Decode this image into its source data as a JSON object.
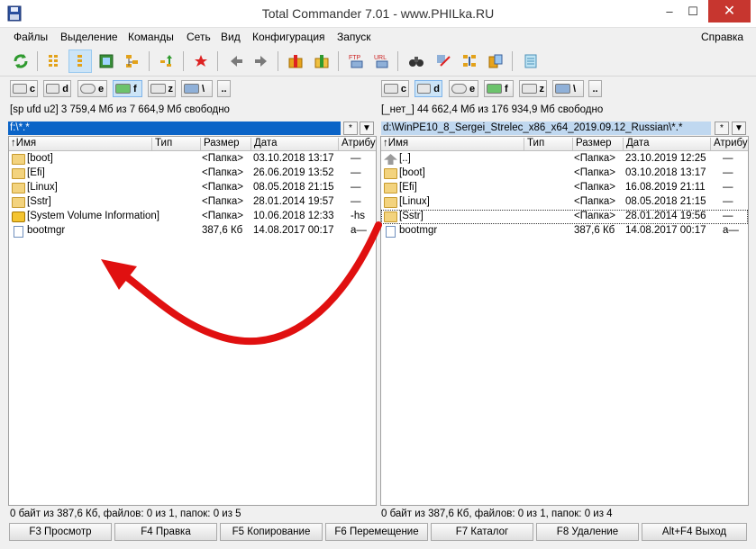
{
  "window": {
    "title": "Total Commander 7.01 - www.PHILka.RU",
    "minimize": "–",
    "maximize": "☐",
    "close": "✕"
  },
  "menu": {
    "items": [
      "Файлы",
      "Выделение",
      "Команды",
      "Сеть",
      "Вид",
      "Конфигурация",
      "Запуск"
    ],
    "help": "Справка"
  },
  "toolbar": {
    "icons": [
      "refresh-icon",
      "brief-view-icon",
      "detailed-view-icon",
      "thumbnail-view-icon",
      "tree-view-icon",
      "invert-selection-icon",
      "unpack-icon",
      "back-icon",
      "forward-icon",
      "pack-icon",
      "extract-icon",
      "ftp-connect-icon",
      "url-download-icon",
      "search-icon",
      "multi-rename-icon",
      "sync-dirs-icon",
      "compare-files-icon",
      "notepad-icon"
    ],
    "ftp_label": "FTP",
    "url_label": "URL"
  },
  "left": {
    "drives": [
      {
        "letter": "c"
      },
      {
        "letter": "d"
      },
      {
        "letter": "e"
      },
      {
        "letter": "f"
      },
      {
        "letter": "z"
      },
      {
        "letter": "\\"
      },
      {
        "letter": ".."
      }
    ],
    "disk_info": "[sp ufd u2]  3 759,4 Мб из 7 664,9 Мб свободно",
    "path": "f:\\*.*",
    "path_btn_star": "*",
    "path_btn_arrow": "▼",
    "columns": {
      "name": "↑Имя",
      "type": "Тип",
      "size": "Размер",
      "date": "Дата",
      "attr": "Атрибу"
    },
    "files": [
      {
        "name": "[boot]",
        "size": "<Папка>",
        "date": "03.10.2018 13:17",
        "attr": "—",
        "icon": "folder-icon"
      },
      {
        "name": "[Efi]",
        "size": "<Папка>",
        "date": "26.06.2019 13:52",
        "attr": "—",
        "icon": "folder-icon"
      },
      {
        "name": "[Linux]",
        "size": "<Папка>",
        "date": "08.05.2018 21:15",
        "attr": "—",
        "icon": "folder-icon"
      },
      {
        "name": "[Sstr]",
        "size": "<Папка>",
        "date": "28.01.2014 19:57",
        "attr": "—",
        "icon": "folder-icon"
      },
      {
        "name": "[System Volume Information]",
        "size": "<Папка>",
        "date": "10.06.2018 12:33",
        "attr": "-hs",
        "icon": "system-folder-icon"
      },
      {
        "name": "bootmgr",
        "size": "387,6 Кб",
        "date": "14.08.2017 00:17",
        "attr": "a—",
        "icon": "file-icon"
      }
    ],
    "status": "0 байт из 387,6 Кб, файлов: 0 из 1, папок: 0 из 5"
  },
  "right": {
    "drives": [
      {
        "letter": "c"
      },
      {
        "letter": "d"
      },
      {
        "letter": "e"
      },
      {
        "letter": "f"
      },
      {
        "letter": "z"
      },
      {
        "letter": "\\"
      },
      {
        "letter": ".."
      }
    ],
    "disk_info": "[_нет_]  44 662,4 Мб из 176 934,9 Мб свободно",
    "path": "d:\\WinPE10_8_Sergei_Strelec_x86_x64_2019.09.12_Russian\\*.*",
    "path_btn_star": "*",
    "path_btn_arrow": "▼",
    "columns": {
      "name": "↑Имя",
      "type": "Тип",
      "size": "Размер",
      "date": "Дата",
      "attr": "Атрибу"
    },
    "files": [
      {
        "name": "[..]",
        "size": "<Папка>",
        "date": "23.10.2019 12:25",
        "attr": "—",
        "icon": "up-dir-icon"
      },
      {
        "name": "[boot]",
        "size": "<Папка>",
        "date": "03.10.2018 13:17",
        "attr": "—",
        "icon": "folder-icon"
      },
      {
        "name": "[Efi]",
        "size": "<Папка>",
        "date": "16.08.2019 21:11",
        "attr": "—",
        "icon": "folder-icon"
      },
      {
        "name": "[Linux]",
        "size": "<Папка>",
        "date": "08.05.2018 21:15",
        "attr": "—",
        "icon": "folder-icon"
      },
      {
        "name": "[Sstr]",
        "size": "<Папка>",
        "date": "28.01.2014 19:56",
        "attr": "—",
        "icon": "folder-icon"
      },
      {
        "name": "bootmgr",
        "size": "387,6 Кб",
        "date": "14.08.2017 00:17",
        "attr": "a—",
        "icon": "file-icon"
      }
    ],
    "status": "0 байт из 387,6 Кб, файлов: 0 из 1, папок: 0 из 4"
  },
  "fkeys": [
    "F3 Просмотр",
    "F4 Правка",
    "F5 Копирование",
    "F6 Перемещение",
    "F7 Каталог",
    "F8 Удаление",
    "Alt+F4 Выход"
  ],
  "annotation": {
    "color": "#e01010"
  }
}
